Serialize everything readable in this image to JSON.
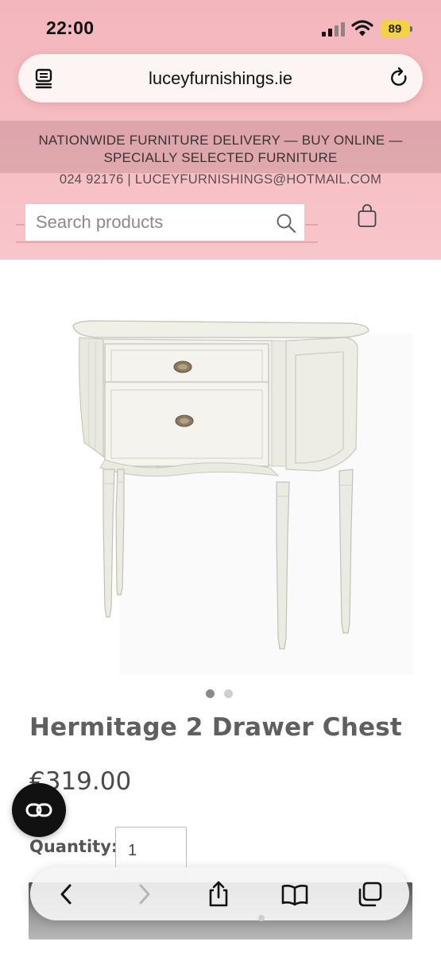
{
  "status_bar": {
    "time": "22:00",
    "battery": "89"
  },
  "browser": {
    "url": "lucey­furnishings.ie"
  },
  "site": {
    "promo": "NATIONWIDE FURNITURE DELIVERY — BUY ONLINE — SPECIALLY SELECTED FURNITURE",
    "contact": "024 92176 | LUCEYFURNISHINGS@HOTMAIL.COM",
    "search_placeholder": "Search products"
  },
  "product": {
    "title": "Hermitage 2 Drawer Chest",
    "price": "€319.00",
    "quantity_label": "Quantity:",
    "quantity_value": "1",
    "image_count": 2,
    "active_image": 1
  },
  "icons": {
    "reader": "reader-icon",
    "reload": "reload-icon",
    "search": "search-icon",
    "bag": "shopping-bag-icon",
    "link": "link-icon",
    "back": "back-icon",
    "forward": "forward-icon",
    "share": "share-icon",
    "bookmarks": "bookmarks-icon",
    "tabs": "tabs-icon"
  },
  "colors": {
    "header_pink": "#f6bcc2",
    "cart_button": "#222222",
    "battery": "#f4d341"
  }
}
